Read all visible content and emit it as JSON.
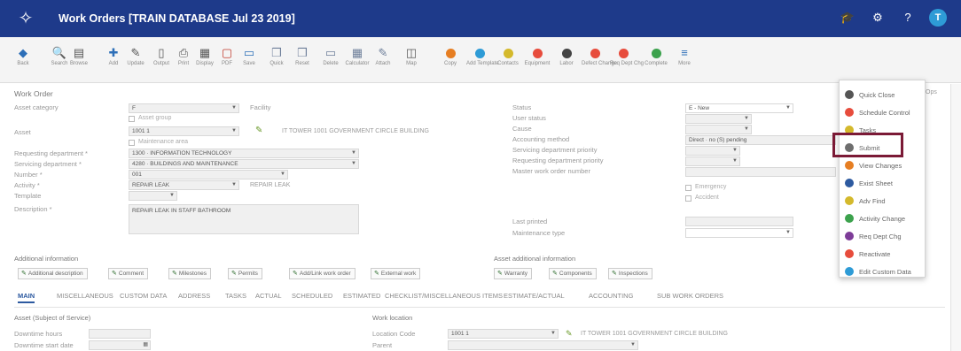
{
  "app": {
    "title": "Work Orders [TRAIN DATABASE Jul 23 2019]"
  },
  "header_icons": [
    {
      "name": "graduation-cap-icon",
      "glyph": "🎓"
    },
    {
      "name": "gear-icon",
      "glyph": "⚙"
    },
    {
      "name": "help-icon",
      "glyph": "?"
    },
    {
      "name": "user-avatar-icon",
      "glyph": "T"
    }
  ],
  "toolbar": [
    {
      "name": "back",
      "label": "Back",
      "glyph": "◆",
      "color": "#2d6fb8"
    },
    {
      "name": "search",
      "label": "Search",
      "glyph": "🔍",
      "color": "#555555"
    },
    {
      "name": "browse",
      "label": "Browse",
      "glyph": "▤",
      "color": "#555555"
    },
    {
      "name": "add",
      "label": "Add",
      "glyph": "✚",
      "color": "#2d6fb8"
    },
    {
      "name": "update",
      "label": "Update",
      "glyph": "✎",
      "color": "#555555"
    },
    {
      "name": "output",
      "label": "Output",
      "glyph": "▯",
      "color": "#555555"
    },
    {
      "name": "print",
      "label": "Print",
      "glyph": "⎙",
      "color": "#555555"
    },
    {
      "name": "display",
      "label": "Display",
      "glyph": "▦",
      "color": "#555555"
    },
    {
      "name": "pdf",
      "label": "PDF",
      "glyph": "▢",
      "color": "#c0392b"
    },
    {
      "name": "save",
      "label": "Save",
      "glyph": "▭",
      "color": "#2d6fb8"
    },
    {
      "name": "quick",
      "label": "Quick",
      "glyph": "❒",
      "color": "#6e7f9a"
    },
    {
      "name": "reset",
      "label": "Reset",
      "glyph": "❒",
      "color": "#6e7f9a"
    },
    {
      "name": "delete",
      "label": "Delete",
      "glyph": "▭",
      "color": "#6e7f9a"
    },
    {
      "name": "calculator",
      "label": "Calculator",
      "glyph": "▦",
      "color": "#6e7f9a"
    },
    {
      "name": "attach",
      "label": "Attach",
      "glyph": "✎",
      "color": "#6e7f9a"
    },
    {
      "name": "map",
      "label": "Map",
      "glyph": "◫",
      "color": "#555555"
    },
    {
      "name": "copy",
      "label": "Copy",
      "dot": "#e67e22"
    },
    {
      "name": "add-template",
      "label": "Add Template",
      "dot": "#2e9bd6"
    },
    {
      "name": "contacts",
      "label": "Contacts",
      "dot": "#d4b92c"
    },
    {
      "name": "equipment",
      "label": "Equipment",
      "dot": "#e74c3c"
    },
    {
      "name": "labor",
      "label": "Labor",
      "dot": "#444444"
    },
    {
      "name": "defect-change",
      "label": "Defect Change",
      "dot": "#e74c3c"
    },
    {
      "name": "req-dept-chg",
      "label": "Req Dept Chg",
      "dot": "#e74c3c"
    },
    {
      "name": "complete",
      "label": "Complete",
      "dot": "#3ca24d"
    },
    {
      "name": "more",
      "label": "More",
      "glyph": "≡",
      "color": "#2d6fb8"
    }
  ],
  "work_order": {
    "title": "Work Order",
    "labels": {
      "asset_category": "Asset category",
      "facility": "Facility",
      "asset": "Asset",
      "requesting_department": "Requesting department *",
      "servicing_department": "Servicing department *",
      "number": "Number *",
      "activity": "Activity *",
      "template": "Template",
      "description": "Description *",
      "status": "Status",
      "user_status": "User status",
      "cause": "Cause",
      "accounting_method": "Accounting method",
      "servicing_department_priority": "Servicing department priority",
      "requesting_department_priority": "Requesting department priority",
      "master_work_order_number": "Master work order number",
      "emergency": "Emergency",
      "accident": "Accident",
      "last_printed": "Last printed",
      "maintenance_type": "Maintenance type"
    },
    "values": {
      "asset_category": "F",
      "asset": "1001 1",
      "asset_description": "IT TOWER 1001 GOVERNMENT CIRCLE BUILDING",
      "requesting_department": "1300 · INFORMATION TECHNOLOGY",
      "servicing_department": "4280 · BUILDINGS AND MAINTENANCE",
      "number": "001",
      "activity": "REPAIR LEAK",
      "activity_description": "REPAIR LEAK",
      "description": "REPAIR LEAK IN STAFF BATHROOM",
      "status": "E - New",
      "accounting_method": "Direct · no (S) pending"
    },
    "checkbox_labels": {
      "asset_group": "Asset group",
      "maintenance_area": "Maintenance area"
    }
  },
  "sections": {
    "additional_information": "Additional information",
    "asset_additional_information": "Asset additional information",
    "additional_buttons": [
      "Additional description",
      "Comment",
      "Milestones",
      "Permits",
      "Add/Link work order",
      "External work"
    ],
    "asset_buttons": [
      "Warranty",
      "Components",
      "Inspections"
    ]
  },
  "tabs": [
    "MAIN",
    "MISCELLANEOUS",
    "CUSTOM DATA",
    "ADDRESS",
    "TASKS",
    "ACTUAL",
    "SCHEDULED",
    "ESTIMATED",
    "CHECKLIST/MISCELLANEOUS ITEMS",
    "ESTIMATE/ACTUAL",
    "ACCOUNTING",
    "SUB WORK ORDERS"
  ],
  "bottom": {
    "asset_subject": "Asset (Subject of Service)",
    "downtime_hours": "Downtime hours",
    "downtime_start_date": "Downtime start date",
    "work_location": "Work location",
    "location_code": "Location Code",
    "parent": "Parent",
    "location_value": "1001 1",
    "location_description": "IT TOWER 1001 GOVERNMENT CIRCLE BUILDING"
  },
  "more_menu": {
    "items": [
      {
        "label": "Quick Close",
        "color": "#555555"
      },
      {
        "label": "Schedule Control",
        "color": "#e74c3c"
      },
      {
        "label": "Tasks",
        "color": "#d4b92c"
      },
      {
        "label": "Submit",
        "color": "#6e6e6e"
      },
      {
        "label": "View Changes",
        "color": "#e67e22"
      },
      {
        "label": "Exist Sheet",
        "color": "#2d5aa0"
      },
      {
        "label": "Adv Find",
        "color": "#d4b92c"
      },
      {
        "label": "Activity Change",
        "color": "#3ca24d"
      },
      {
        "label": "Req Dept Chg",
        "color": "#7d3c98"
      },
      {
        "label": "Reactivate",
        "color": "#e74c3c"
      },
      {
        "label": "Edit Custom Data",
        "color": "#2e9bd6"
      }
    ],
    "highlighted": "Submit"
  },
  "misc": {
    "ops_label": "Ops"
  }
}
